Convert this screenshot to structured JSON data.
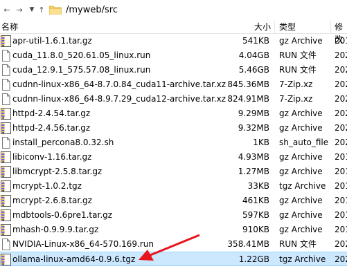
{
  "path": "/myweb/src",
  "columns": {
    "name": "名称",
    "size": "大小",
    "type": "类型",
    "date": "修改"
  },
  "files": [
    {
      "name": "apr-util-1.6.1.tar.gz",
      "size": "541KB",
      "type": "gz Archive",
      "date": "201",
      "icon": "archive-icon"
    },
    {
      "name": "cuda_11.8.0_520.61.05_linux.run",
      "size": "4.04GB",
      "type": "RUN 文件",
      "date": "202",
      "icon": "file-icon"
    },
    {
      "name": "cuda_12.9.1_575.57.08_linux.run",
      "size": "5.46GB",
      "type": "RUN 文件",
      "date": "202",
      "icon": "file-icon"
    },
    {
      "name": "cudnn-linux-x86_64-8.7.0.84_cuda11-archive.tar.xz",
      "size": "845.36MB",
      "type": "7-Zip.xz",
      "date": "202",
      "icon": "file-icon"
    },
    {
      "name": "cudnn-linux-x86_64-8.9.7.29_cuda12-archive.tar.xz",
      "size": "824.91MB",
      "type": "7-Zip.xz",
      "date": "202",
      "icon": "file-icon"
    },
    {
      "name": "httpd-2.4.54.tar.gz",
      "size": "9.29MB",
      "type": "gz Archive",
      "date": "202",
      "icon": "archive-icon"
    },
    {
      "name": "httpd-2.4.56.tar.gz",
      "size": "9.32MB",
      "type": "gz Archive",
      "date": "202",
      "icon": "archive-icon"
    },
    {
      "name": "install_percona8.0.32.sh",
      "size": "1KB",
      "type": "sh_auto_file",
      "date": "202",
      "icon": "file-icon"
    },
    {
      "name": "libiconv-1.16.tar.gz",
      "size": "4.93MB",
      "type": "gz Archive",
      "date": "201",
      "icon": "archive-icon"
    },
    {
      "name": "libmcrypt-2.5.8.tar.gz",
      "size": "1.27MB",
      "type": "gz Archive",
      "date": "201",
      "icon": "archive-icon"
    },
    {
      "name": "mcrypt-1.0.2.tgz",
      "size": "33KB",
      "type": "tgz Archive",
      "date": "201",
      "icon": "archive-icon"
    },
    {
      "name": "mcrypt-2.6.8.tar.gz",
      "size": "461KB",
      "type": "gz Archive",
      "date": "201",
      "icon": "archive-icon"
    },
    {
      "name": "mdbtools-0.6pre1.tar.gz",
      "size": "597KB",
      "type": "gz Archive",
      "date": "201",
      "icon": "archive-icon"
    },
    {
      "name": "mhash-0.9.9.9.tar.gz",
      "size": "910KB",
      "type": "gz Archive",
      "date": "201",
      "icon": "archive-icon"
    },
    {
      "name": "NVIDIA-Linux-x86_64-570.169.run",
      "size": "358.41MB",
      "type": "RUN 文件",
      "date": "202",
      "icon": "file-icon"
    },
    {
      "name": "ollama-linux-amd64-0.9.6.tgz",
      "size": "1.22GB",
      "type": "tgz Archive",
      "date": "202",
      "icon": "archive-icon",
      "selected": true
    }
  ],
  "colors": {
    "selection": "#cce8ff",
    "selection_border": "#99d1ff",
    "arrow": "#e8141c",
    "folder": "#f8d775"
  }
}
